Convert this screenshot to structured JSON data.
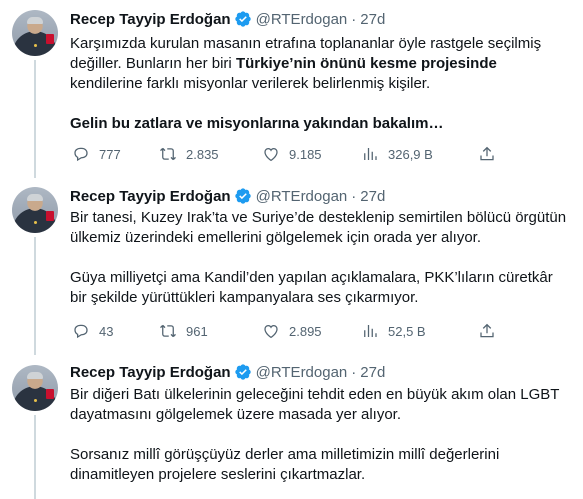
{
  "tweets": [
    {
      "author": {
        "name": "Recep Tayyip Erdoğan",
        "handle": "@RTErdogan",
        "separator": "·",
        "time": "27d"
      },
      "paragraphs": [
        [
          {
            "t": "Karşımızda kurulan masanın etrafına toplananlar öyle rastgele seçilmiş değiller. Bunların her biri ",
            "b": false
          },
          {
            "t": "Türkiye’nin önünü kesme projesinde",
            "b": true
          },
          {
            "t": " kendilerine farklı misyonlar verilerek belirlenmiş kişiler.",
            "b": false
          }
        ],
        [
          {
            "t": "Gelin bu zatlara ve misyonlarına yakından bakalım…",
            "b": true
          }
        ]
      ],
      "stats": {
        "replies": "777",
        "retweets": "2.835",
        "likes": "9.185",
        "views": "326,9 B"
      }
    },
    {
      "author": {
        "name": "Recep Tayyip Erdoğan",
        "handle": "@RTErdogan",
        "separator": "·",
        "time": "27d"
      },
      "paragraphs": [
        [
          {
            "t": "Bir tanesi, Kuzey Irak’ta ve Suriye’de desteklenip semirtilen bölücü örgütün ülkemiz üzerindeki emellerini gölgelemek için orada yer alıyor.",
            "b": false
          }
        ],
        [
          {
            "t": "Güya milliyetçi ama Kandil’den yapılan açıklamalara, PKK’lıların cüretkâr bir şekilde yürüttükleri kampanyalara ses çıkarmıyor.",
            "b": false
          }
        ]
      ],
      "stats": {
        "replies": "43",
        "retweets": "961",
        "likes": "2.895",
        "views": "52,5 B"
      }
    },
    {
      "author": {
        "name": "Recep Tayyip Erdoğan",
        "handle": "@RTErdogan",
        "separator": "·",
        "time": "27d"
      },
      "paragraphs": [
        [
          {
            "t": "Bir diğeri Batı ülkelerinin geleceğini tehdit eden en büyük akım olan LGBT dayatmasını gölgelemek üzere masada yer alıyor.",
            "b": false
          }
        ],
        [
          {
            "t": "Sorsanız millî görüşçüyüz derler ama milletimizin millî değerlerini dinamitleyen projelere seslerini çıkartmazlar.",
            "b": false
          }
        ]
      ],
      "stats": null
    }
  ],
  "colors": {
    "text": "#0f1419",
    "secondary": "#536471",
    "verified": "#1d9bf0",
    "thread_line": "#cfd9de"
  },
  "icons": {
    "verified": "verified-badge-icon",
    "reply": "reply-icon",
    "retweet": "retweet-icon",
    "like": "heart-icon",
    "views": "views-chart-icon",
    "share": "share-icon"
  }
}
